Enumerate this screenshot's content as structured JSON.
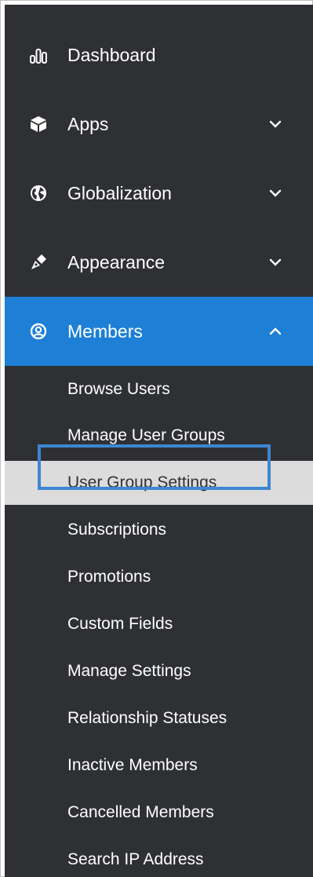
{
  "sidebar": {
    "items": [
      {
        "label": "Dashboard",
        "icon": "bar-chart-icon",
        "expandable": false
      },
      {
        "label": "Apps",
        "icon": "cube-icon",
        "expandable": true
      },
      {
        "label": "Globalization",
        "icon": "globe-icon",
        "expandable": true
      },
      {
        "label": "Appearance",
        "icon": "pen-icon",
        "expandable": true
      },
      {
        "label": "Members",
        "icon": "user-circle-icon",
        "expandable": true,
        "expanded": true,
        "active": true
      }
    ],
    "members_submenu": [
      {
        "label": "Browse Users"
      },
      {
        "label": "Manage User Groups"
      },
      {
        "label": "User Group Settings",
        "highlighted": true
      },
      {
        "label": "Subscriptions"
      },
      {
        "label": "Promotions"
      },
      {
        "label": "Custom Fields"
      },
      {
        "label": "Manage Settings"
      },
      {
        "label": "Relationship Statuses"
      },
      {
        "label": "Inactive Members"
      },
      {
        "label": "Cancelled Members"
      },
      {
        "label": "Search IP Address"
      }
    ]
  },
  "colors": {
    "sidebar_bg": "#2f3034",
    "active_bg": "#1d7fd6",
    "highlight_bg": "#dcdcdc",
    "focus_outline": "#3d86d1"
  }
}
